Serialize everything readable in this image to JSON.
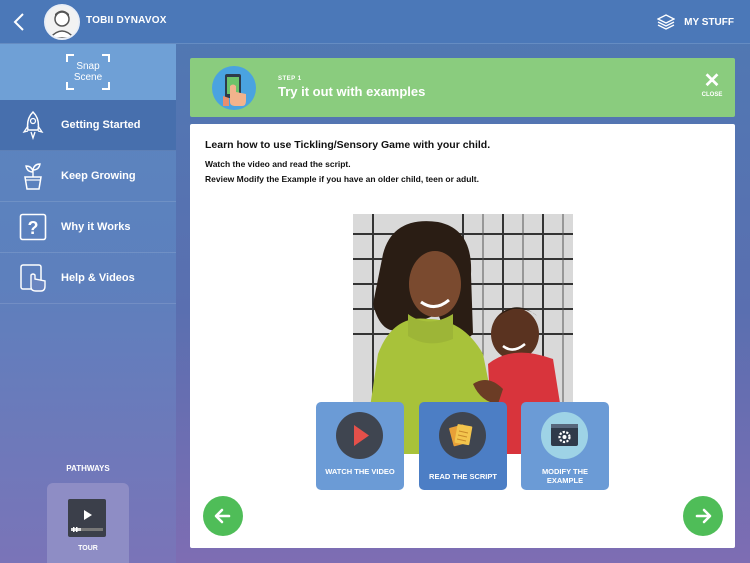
{
  "topbar": {
    "back_icon": "chevron-left-icon",
    "user_name": "TOBII DYNAVOX",
    "my_stuff_label": "MY STUFF",
    "my_stuff_icon": "layers-icon"
  },
  "sidebar": {
    "logo_text_1": "Snap",
    "logo_text_2": "Scene",
    "items": [
      {
        "label": "Getting Started",
        "icon": "rocket-icon",
        "active": true
      },
      {
        "label": "Keep Growing",
        "icon": "plant-icon",
        "active": false
      },
      {
        "label": "Why it Works",
        "icon": "question-icon",
        "active": false
      },
      {
        "label": "Help & Videos",
        "icon": "tablet-touch-icon",
        "active": false
      }
    ],
    "pathways_label": "PATHWAYS",
    "tour_label": "TOUR"
  },
  "step": {
    "number": "STEP 1",
    "title": "Try it out with examples",
    "close_label": "CLOSE",
    "banner_color": "#8acc7e"
  },
  "content": {
    "heading": "Learn how to use Tickling/Sensory Game with your child.",
    "line1": "Watch the video and read the script.",
    "line2": "Review Modify the Example if you have an older child, teen or adult."
  },
  "actions": [
    {
      "label": "WATCH THE VIDEO",
      "icon": "play-icon"
    },
    {
      "label": "READ THE SCRIPT",
      "icon": "script-cards-icon"
    },
    {
      "label": "MODIFY THE EXAMPLE",
      "icon": "gear-window-icon"
    }
  ],
  "colors": {
    "accent_green": "#4fbd58",
    "tile_blue": "#6b9bd6"
  }
}
